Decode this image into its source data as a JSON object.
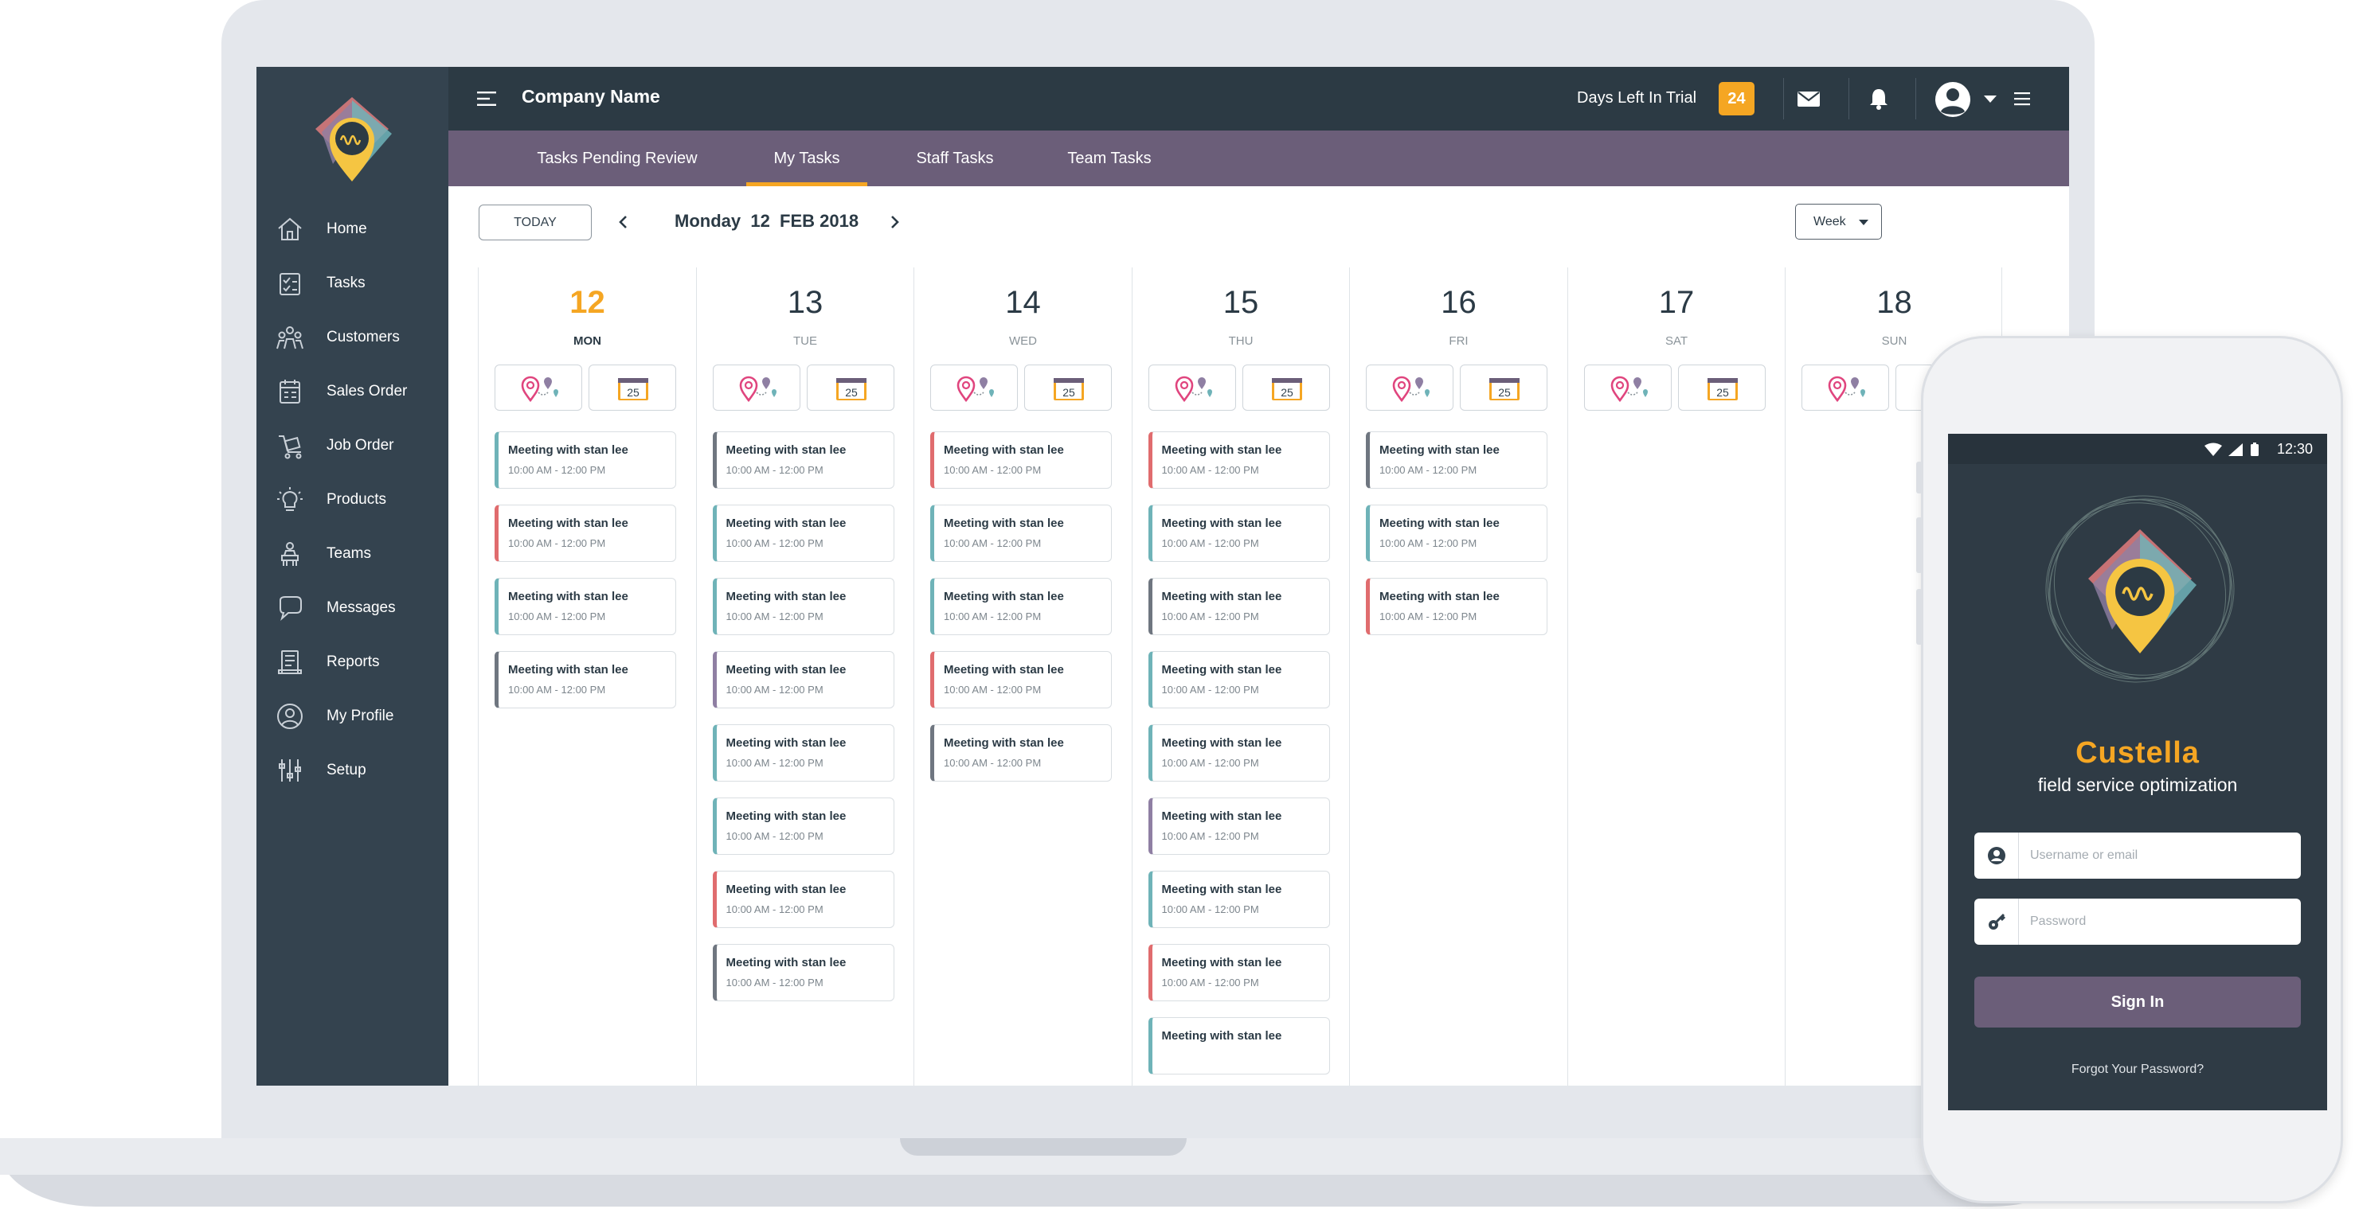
{
  "app": {
    "company_name": "Company Name",
    "trial_label": "Days Left In Trial",
    "trial_days": "24"
  },
  "sidebar": {
    "items": [
      {
        "label": "Home",
        "icon": "home-icon"
      },
      {
        "label": "Tasks",
        "icon": "tasks-icon"
      },
      {
        "label": "Customers",
        "icon": "customers-icon"
      },
      {
        "label": "Sales Order",
        "icon": "sales-order-icon"
      },
      {
        "label": "Job Order",
        "icon": "job-order-icon"
      },
      {
        "label": "Products",
        "icon": "products-icon"
      },
      {
        "label": "Teams",
        "icon": "teams-icon"
      },
      {
        "label": "Messages",
        "icon": "messages-icon"
      },
      {
        "label": "Reports",
        "icon": "reports-icon"
      },
      {
        "label": "My Profile",
        "icon": "profile-icon"
      },
      {
        "label": "Setup",
        "icon": "setup-icon"
      }
    ]
  },
  "tabs": [
    {
      "label": "Tasks Pending Review",
      "active": false
    },
    {
      "label": "My Tasks",
      "active": true
    },
    {
      "label": "Staff Tasks",
      "active": false
    },
    {
      "label": "Team Tasks",
      "active": false
    }
  ],
  "toolbar": {
    "today_label": "TODAY",
    "current_date": "Monday  12  FEB 2018",
    "view_select": "Week"
  },
  "calendar": {
    "icon_badge": "25",
    "days": [
      {
        "num": "12",
        "name": "MON",
        "today": true,
        "events": [
          {
            "title": "Meeting with stan lee",
            "start": "10:00 AM",
            "end": "12:00 PM",
            "color": "#6fb3b8"
          },
          {
            "title": "Meeting with stan lee",
            "start": "10:00 AM",
            "end": "12:00 PM",
            "color": "#e06c6e"
          },
          {
            "title": "Meeting with stan lee",
            "start": "10:00 AM",
            "end": "12:00 PM",
            "color": "#6fb3b8"
          },
          {
            "title": "Meeting with stan lee",
            "start": "10:00 AM",
            "end": "12:00 PM",
            "color": "#6f7680"
          }
        ]
      },
      {
        "num": "13",
        "name": "TUE",
        "today": false,
        "events": [
          {
            "title": "Meeting with stan lee",
            "start": "10:00 AM",
            "end": "12:00 PM",
            "color": "#6f7680"
          },
          {
            "title": "Meeting with stan lee",
            "start": "10:00 AM",
            "end": "12:00 PM",
            "color": "#6fb3b8"
          },
          {
            "title": "Meeting with stan lee",
            "start": "10:00 AM",
            "end": "12:00 PM",
            "color": "#6fb3b8"
          },
          {
            "title": "Meeting with stan lee",
            "start": "10:00 AM",
            "end": "12:00 PM",
            "color": "#8f7fa3"
          },
          {
            "title": "Meeting with stan lee",
            "start": "10:00 AM",
            "end": "12:00 PM",
            "color": "#6fb3b8"
          },
          {
            "title": "Meeting with stan lee",
            "start": "10:00 AM",
            "end": "12:00 PM",
            "color": "#6fb3b8"
          },
          {
            "title": "Meeting with stan lee",
            "start": "10:00 AM",
            "end": "12:00 PM",
            "color": "#e06c6e"
          },
          {
            "title": "Meeting with stan lee",
            "start": "10:00 AM",
            "end": "12:00 PM",
            "color": "#6f7680"
          }
        ]
      },
      {
        "num": "14",
        "name": "WED",
        "today": false,
        "events": [
          {
            "title": "Meeting with stan lee",
            "start": "10:00 AM",
            "end": "12:00 PM",
            "color": "#e06c6e"
          },
          {
            "title": "Meeting with stan lee",
            "start": "10:00 AM",
            "end": "12:00 PM",
            "color": "#6fb3b8"
          },
          {
            "title": "Meeting with stan lee",
            "start": "10:00 AM",
            "end": "12:00 PM",
            "color": "#6fb3b8"
          },
          {
            "title": "Meeting with stan lee",
            "start": "10:00 AM",
            "end": "12:00 PM",
            "color": "#e06c6e"
          },
          {
            "title": "Meeting with stan lee",
            "start": "10:00 AM",
            "end": "12:00 PM",
            "color": "#6f7680"
          }
        ]
      },
      {
        "num": "15",
        "name": "THU",
        "today": false,
        "events": [
          {
            "title": "Meeting with stan lee",
            "start": "10:00 AM",
            "end": "12:00 PM",
            "color": "#e06c6e"
          },
          {
            "title": "Meeting with stan lee",
            "start": "10:00 AM",
            "end": "12:00 PM",
            "color": "#6fb3b8"
          },
          {
            "title": "Meeting with stan lee",
            "start": "10:00 AM",
            "end": "12:00 PM",
            "color": "#6f7680"
          },
          {
            "title": "Meeting with stan lee",
            "start": "10:00 AM",
            "end": "12:00 PM",
            "color": "#6fb3b8"
          },
          {
            "title": "Meeting with stan lee",
            "start": "10:00 AM",
            "end": "12:00 PM",
            "color": "#6fb3b8"
          },
          {
            "title": "Meeting with stan lee",
            "start": "10:00 AM",
            "end": "12:00 PM",
            "color": "#8f7fa3"
          },
          {
            "title": "Meeting with stan lee",
            "start": "10:00 AM",
            "end": "12:00 PM",
            "color": "#6fb3b8"
          },
          {
            "title": "Meeting with stan lee",
            "start": "10:00 AM",
            "end": "12:00 PM",
            "color": "#e06c6e"
          },
          {
            "title": "Meeting with stan lee",
            "start": "",
            "end": "",
            "color": "#6fb3b8"
          }
        ]
      },
      {
        "num": "16",
        "name": "FRI",
        "today": false,
        "events": [
          {
            "title": "Meeting with stan lee",
            "start": "10:00 AM",
            "end": "12:00 PM",
            "color": "#6f7680"
          },
          {
            "title": "Meeting with stan lee",
            "start": "10:00 AM",
            "end": "12:00 PM",
            "color": "#6fb3b8"
          },
          {
            "title": "Meeting with stan lee",
            "start": "10:00 AM",
            "end": "12:00 PM",
            "color": "#e06c6e"
          }
        ]
      },
      {
        "num": "17",
        "name": "SAT",
        "today": false,
        "events": []
      },
      {
        "num": "18",
        "name": "SUN",
        "today": false,
        "events": []
      }
    ]
  },
  "phone": {
    "status_time": "12:30",
    "brand": "Custella",
    "tagline": "field service optimization",
    "username_placeholder": "Username or email",
    "password_placeholder": "Password",
    "signin_label": "Sign In",
    "forgot_label": "Forgot Your Password?"
  },
  "colors": {
    "accent": "#f5a623",
    "sidebar_bg": "#34434f",
    "header_bg": "#2c3a44",
    "tabs_bg": "#6b5e79"
  }
}
